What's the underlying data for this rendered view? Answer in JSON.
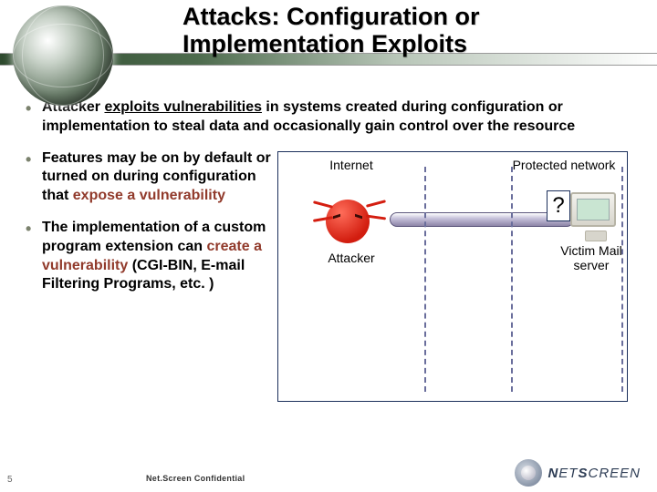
{
  "title": "Attacks: Configuration or Implementation Exploits",
  "bullets": {
    "b1_pre": "Attacker ",
    "b1_ul": "exploits vulnerabilities",
    "b1_post": " in systems created during configuration or implementation to steal data and occasionally gain control over the resource",
    "b2_pre": "Features may be on by default or turned on during configuration that ",
    "b2_hl": "expose a vulnerability",
    "b3_pre": "The implementation of a custom program extension can ",
    "b3_hl": "create a vulnerability",
    "b3_post": " (CGI-BIN, E-mail Filtering Programs, etc. )"
  },
  "diagram": {
    "internet": "Internet",
    "protected": "Protected network",
    "attacker": "Attacker",
    "victim": "Victim Mail server",
    "qmark": "?"
  },
  "footer": {
    "page": "5",
    "confidential": "Net.Screen Confidential",
    "brand_a": "N",
    "brand_b": "ET",
    "brand_c": "S",
    "brand_d": "CREEN"
  }
}
